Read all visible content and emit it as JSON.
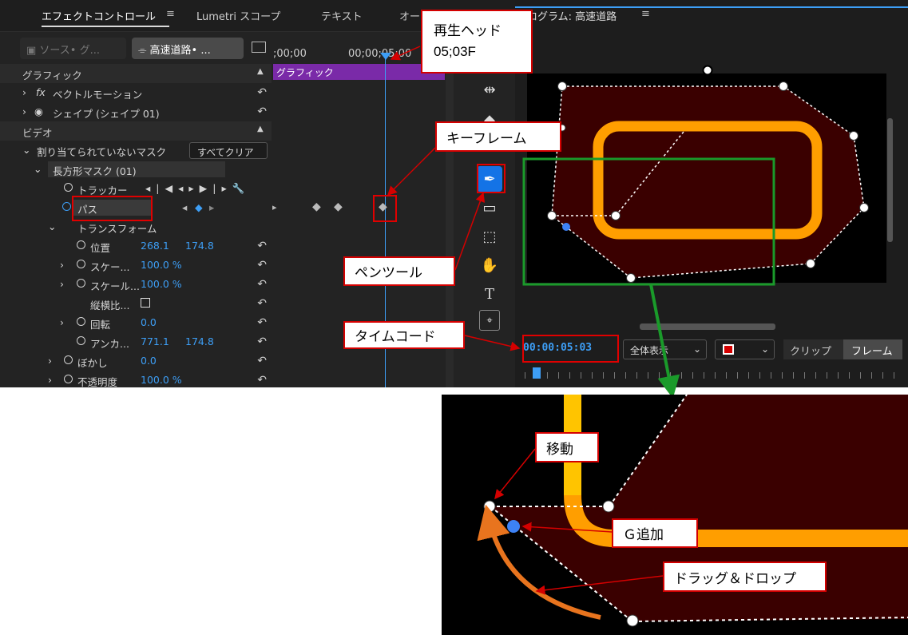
{
  "tabs": {
    "effect_controls": "エフェクトコントロール",
    "lumetri": "Lumetri スコープ",
    "text": "テキスト",
    "more": "オー",
    "menu": "≡"
  },
  "source_chip": "ソース• グ...",
  "clip_chip": "高速道路• ...",
  "timecodes": {
    "t0": ";00;00",
    "t1": "00;00;05;00"
  },
  "timeline_clip": "グラフィック",
  "rows": {
    "graphic": "グラフィック",
    "vector": "ベクトルモーション",
    "fx": "fx",
    "shape": "シェイプ (シェイプ 01)",
    "video": "ビデオ",
    "mask_group": "割り当てられていないマスク",
    "clear_all": "すべてクリア",
    "rect_mask": "長方形マスク (01)",
    "tracker": "トラッカー",
    "path": "パス",
    "transform": "トランスフォーム",
    "position": "位置",
    "position_x": "268.1",
    "position_y": "174.8",
    "scale1": "スケー...",
    "scale1_val": "100.0 %",
    "scale2": "スケール...",
    "scale2_val": "100.0 %",
    "aspect": "縦横比...",
    "rotation": "回転",
    "rotation_val": "0.0",
    "anchor": "アンカ...",
    "anchor_x": "771.1",
    "anchor_y": "174.8",
    "blur": "ぼかし",
    "blur_val": "0.0",
    "opacity": "不透明度",
    "opacity_val": "100.0 %"
  },
  "program": {
    "title": "プログラム: 高速道路",
    "menu": "≡",
    "timecode": "00:00:05:03",
    "fit": "全体表示",
    "clip": "クリップ",
    "frame": "フレーム"
  },
  "callouts": {
    "playhead": "再生ヘッド",
    "playhead2": "05;03F",
    "keyframe": "キーフレーム",
    "pen": "ペンツール",
    "timecode": "タイムコード",
    "move": "移動",
    "add": "Ｇ追加",
    "drag": "ドラッグ＆ドロップ"
  },
  "colors": {
    "panel": "#232323",
    "accent": "#3d9ef5",
    "orange": "#ff9e00",
    "mask_fill": "#3a0000",
    "callout_border": "#d40000",
    "green": "#1a9a2a"
  }
}
